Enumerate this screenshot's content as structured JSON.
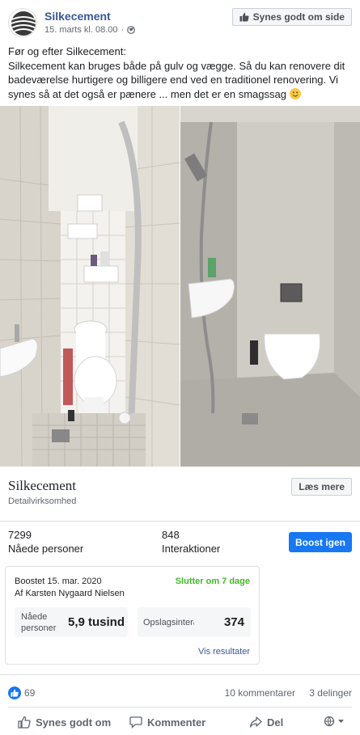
{
  "header": {
    "page_name": "Silkecement",
    "timestamp": "15. marts kl. 08.00",
    "like_page_label": "Synes godt om side"
  },
  "post": {
    "line1": "Før og efter Silkecement:",
    "line2": "Silkecement kan bruges både på gulv og vægge. Så du kan renovere dit badeværelse hurtigere og billigere end ved en traditionel renovering. Vi synes så at det også er pænere ... men det er en smagssag"
  },
  "link_card": {
    "title": "Silkecement",
    "subtitle": "Detailvirksomhed",
    "button_label": "Læs mere"
  },
  "stats": {
    "reach_value": "7299",
    "reach_label": "Nåede personer",
    "interactions_value": "848",
    "interactions_label": "Interaktioner",
    "boost_label": "Boost igen"
  },
  "boost": {
    "title": "Boostet 15. mar. 2020",
    "by": "Af Karsten Nygaard Nielsen",
    "ends": "Slutter om 7 dage",
    "metric1_label_a": "Nåede",
    "metric1_label_b": "personer",
    "metric1_value": "5,9 tusind",
    "metric2_label": "Opslagsinteraktioner",
    "metric2_value": "374",
    "view_results": "Vis resultater"
  },
  "reactions": {
    "count": "69",
    "comments": "10 kommentarer",
    "shares": "3 delinger"
  },
  "actions": {
    "like": "Synes godt om",
    "comment": "Kommenter",
    "share": "Del"
  },
  "colors": {
    "brand_blue": "#1877f2",
    "link_blue": "#385898",
    "green": "#42b72a"
  },
  "icons": [
    "avatar-logo",
    "globe-icon",
    "thumbs-up-icon",
    "smile-emoji",
    "comment-icon",
    "share-icon",
    "audience-dropdown-icon"
  ]
}
